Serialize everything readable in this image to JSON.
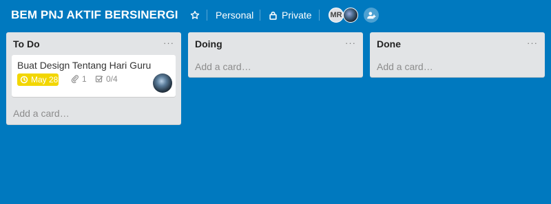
{
  "board": {
    "title": "BEM PNJ AKTIF BERSINERGI",
    "team": "Personal",
    "visibility": "Private",
    "members": [
      {
        "initials": "MR"
      },
      {
        "initials": ""
      }
    ]
  },
  "lists": [
    {
      "title": "To Do",
      "menu": "···",
      "add_card": "Add a card…",
      "cards": [
        {
          "title": "Buat Design Tentang Hari Guru",
          "due": "May 28",
          "attachments": "1",
          "checklist": "0/4"
        }
      ]
    },
    {
      "title": "Doing",
      "menu": "···",
      "add_card": "Add a card…"
    },
    {
      "title": "Done",
      "menu": "···",
      "add_card": "Add a card…"
    }
  ],
  "colors": {
    "background": "#0079bf",
    "list": "#e2e4e6",
    "due_badge": "#f2d600"
  }
}
